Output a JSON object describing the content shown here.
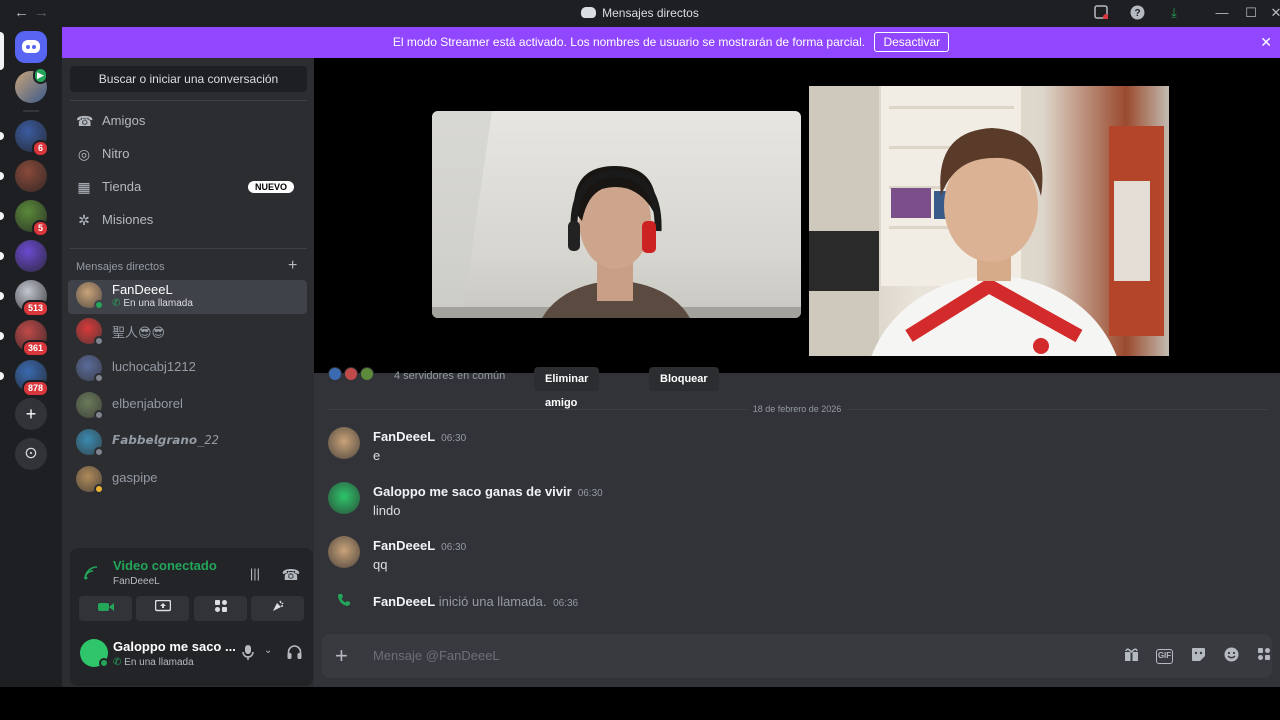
{
  "titlebar": {
    "back": "←",
    "forward": "→",
    "title": "Mensajes directos",
    "icons": [
      "inbox-icon",
      "help-icon",
      "download-icon",
      "minimize-icon",
      "maximize-icon",
      "close-icon"
    ]
  },
  "rail": {
    "servers": [
      {
        "name": "server-1",
        "badge": "6",
        "color": "#3b5ba0"
      },
      {
        "name": "server-2",
        "badge": "",
        "color": "#8a4a3a"
      },
      {
        "name": "server-3",
        "badge": "5",
        "color": "#5a8a3a"
      },
      {
        "name": "server-4",
        "badge": "",
        "color": "#6a4ad0"
      },
      {
        "name": "server-5",
        "badge": "513",
        "color": "#c2c6d0"
      },
      {
        "name": "server-6",
        "badge": "361",
        "color": "#c04a4a"
      },
      {
        "name": "server-7",
        "badge": "878",
        "color": "#3a6ab0"
      }
    ],
    "add_label": "+",
    "discover_label": "⊙"
  },
  "banner": {
    "text": "El modo Streamer está activado. Los nombres de usuario se mostrarán de forma parcial.",
    "button": "Desactivar",
    "close": "✕"
  },
  "sidebar": {
    "search": "Buscar o iniciar una conversación",
    "nav": [
      {
        "label": "Amigos",
        "icon": "friends-icon",
        "glyph": "☎"
      },
      {
        "label": "Nitro",
        "icon": "nitro-icon",
        "glyph": "◎"
      },
      {
        "label": "Tienda",
        "icon": "shop-icon",
        "glyph": "▦",
        "badge": "NUEVO"
      },
      {
        "label": "Misiones",
        "icon": "quests-icon",
        "glyph": "✲"
      }
    ],
    "dm_header": "Mensajes directos",
    "dm_plus": "+",
    "dms": [
      {
        "name": "FanDeeeL",
        "sub": "En una llamada",
        "status": "on",
        "color": "#c9a37a",
        "active": true
      },
      {
        "name": "聖人😎😎",
        "sub": "",
        "status": "off",
        "color": "#d83a3a",
        "active": false
      },
      {
        "name": "luchocabj1212",
        "sub": "",
        "status": "off",
        "color": "#5a6a9a",
        "active": false
      },
      {
        "name": "elbenjaborel",
        "sub": "",
        "status": "off",
        "color": "#6a7a5a",
        "active": false
      },
      {
        "name": "𝙁𝙖𝙗𝙗𝙚𝙡𝙜𝙧𝙖𝙣𝙤_22",
        "sub": "",
        "status": "off",
        "color": "#3a8ab0",
        "active": false
      },
      {
        "name": "gaspipe",
        "sub": "",
        "status": "idle",
        "color": "#b08a5a",
        "active": false
      }
    ]
  },
  "voice": {
    "title": "Video conectado",
    "channel": "FanDeeeL",
    "buttons": [
      "camera-icon",
      "screenshare-icon",
      "activities-icon",
      "soundboard-icon"
    ]
  },
  "user": {
    "name": "Galoppo me saco ...",
    "status": "En una llamada"
  },
  "profile": {
    "mutual": "4 servidores en común",
    "remove": "Eliminar amigo",
    "block": "Bloquear"
  },
  "chat": {
    "date": "18 de febrero de 2026",
    "messages": [
      {
        "author": "FanDeeeL",
        "time": "06:30",
        "text": "e",
        "color": "#c9a37a"
      },
      {
        "author": "Galoppo me saco ganas de vivir",
        "time": "06:30",
        "text": "lindo",
        "color": "#2ec56b"
      },
      {
        "author": "FanDeeeL",
        "time": "06:30",
        "text": "qq",
        "color": "#c9a37a"
      }
    ],
    "call_event": {
      "author": "FanDeeeL",
      "text": "inició una llamada.",
      "time": "06:36"
    },
    "composer_placeholder": "Mensaje @FanDeeeL",
    "composer_tools": [
      "gift-icon",
      "gif-icon",
      "sticker-icon",
      "emoji-icon",
      "apps-icon"
    ]
  }
}
